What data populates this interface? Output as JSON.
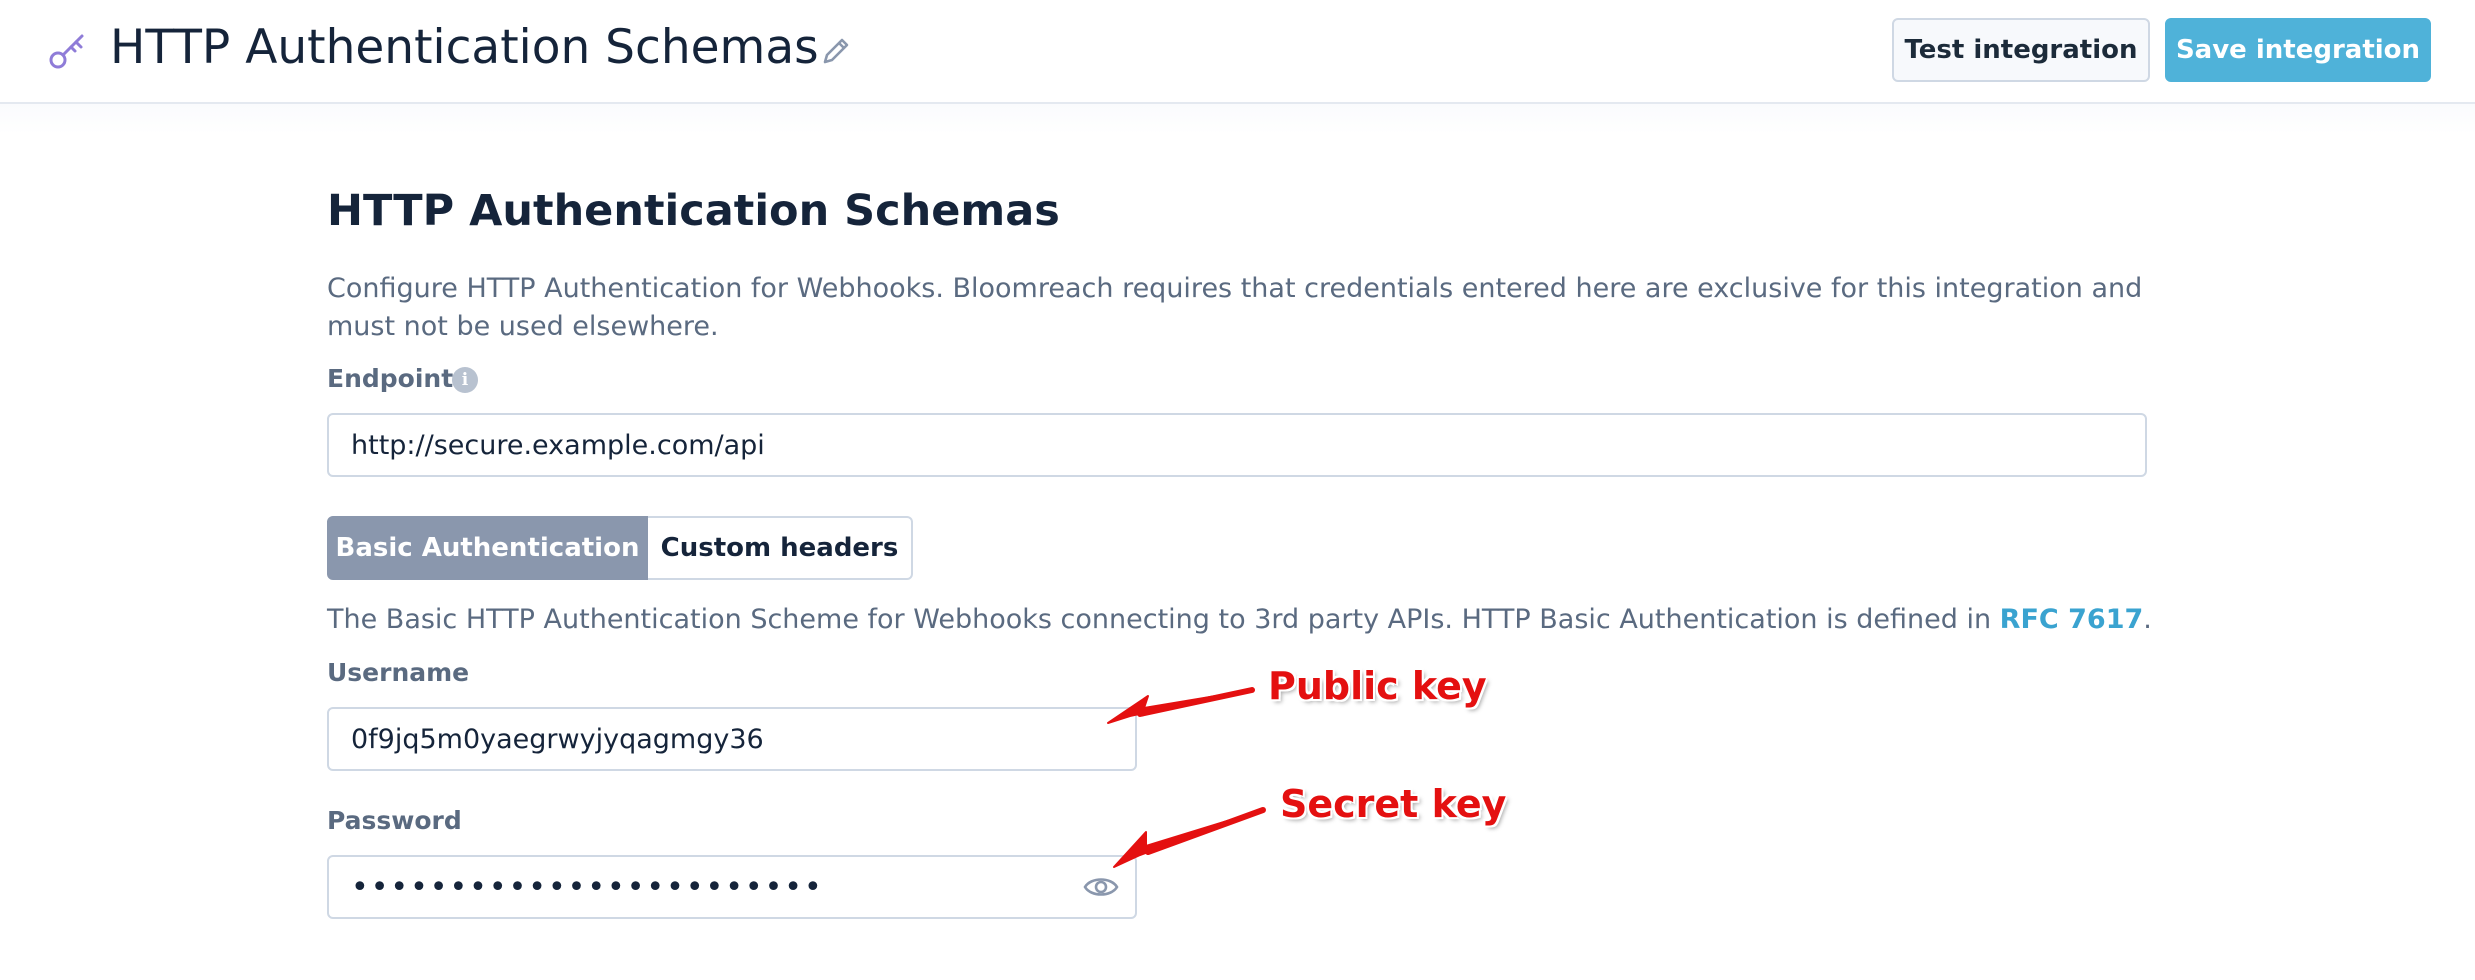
{
  "header": {
    "title": "HTTP Authentication Schemas",
    "icon": "key-icon",
    "edit_icon": "pencil-icon",
    "test_button": "Test integration",
    "save_button": "Save integration"
  },
  "section": {
    "title": "HTTP Authentication Schemas",
    "description": "Configure HTTP Authentication for Webhooks. Bloomreach requires that credentials entered here are exclusive for this integration and must not be used elsewhere."
  },
  "endpoint": {
    "label": "Endpoint",
    "info_icon": "i",
    "value": "http://secure.example.com/api"
  },
  "tabs": [
    {
      "label": "Basic Authentication",
      "active": true
    },
    {
      "label": "Custom headers",
      "active": false
    }
  ],
  "basic": {
    "description": "The Basic HTTP Authentication Scheme for Webhooks connecting to 3rd party APIs. HTTP Basic Authentication is defined in ",
    "link": "RFC 7617",
    "suffix": "."
  },
  "username": {
    "label": "Username",
    "value": "0f9jq5m0yaegrwyjyqagmgy36"
  },
  "password": {
    "label": "Password",
    "masked_value": "••••••••••••••••••••••••",
    "toggle_icon": "eye-icon"
  },
  "annotations": {
    "public_key": "Public key",
    "secret_key": "Secret key",
    "color": "#e41010"
  },
  "colors": {
    "accent": "#4fb2d9",
    "tab_active": "#8a97ad",
    "link": "#3aa3d0"
  }
}
